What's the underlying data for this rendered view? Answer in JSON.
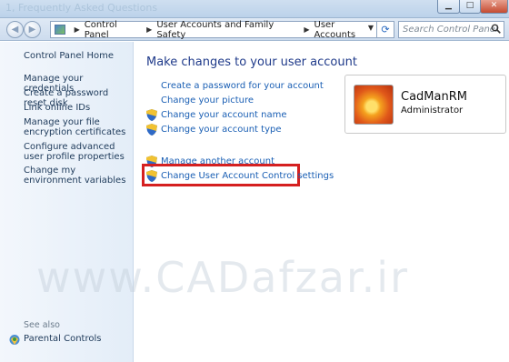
{
  "window": {
    "faded_title": "1, Frequently Asked Questions"
  },
  "address": {
    "crumbs": [
      "Control Panel",
      "User Accounts and Family Safety",
      "User Accounts"
    ],
    "search_placeholder": "Search Control Panel"
  },
  "sidebar": {
    "home": "Control Panel Home",
    "items": [
      {
        "label": "Manage your credentials"
      },
      {
        "label": "Create a password reset disk"
      },
      {
        "label": "Link online IDs"
      },
      {
        "label": "Manage your file encryption certificates"
      },
      {
        "label": "Configure advanced user profile properties"
      },
      {
        "label": "Change my environment variables"
      }
    ],
    "see_also": "See also",
    "parental_controls": "Parental Controls"
  },
  "main": {
    "title": "Make changes to your user account",
    "tasks": [
      {
        "label": "Create a password for your account",
        "shield": false
      },
      {
        "label": "Change your picture",
        "shield": false
      },
      {
        "label": "Change your account name",
        "shield": true
      },
      {
        "label": "Change your account type",
        "shield": true
      }
    ],
    "other_tasks": [
      {
        "label": "Manage another account",
        "shield": true
      },
      {
        "label": "Change User Account Control settings",
        "shield": true
      }
    ]
  },
  "user": {
    "name": "CadManRM",
    "role": "Administrator"
  },
  "watermark": "www.CADafzar.ir",
  "colors": {
    "link": "#1a5fb4",
    "highlight": "#d52020",
    "title": "#1f3a8a"
  }
}
